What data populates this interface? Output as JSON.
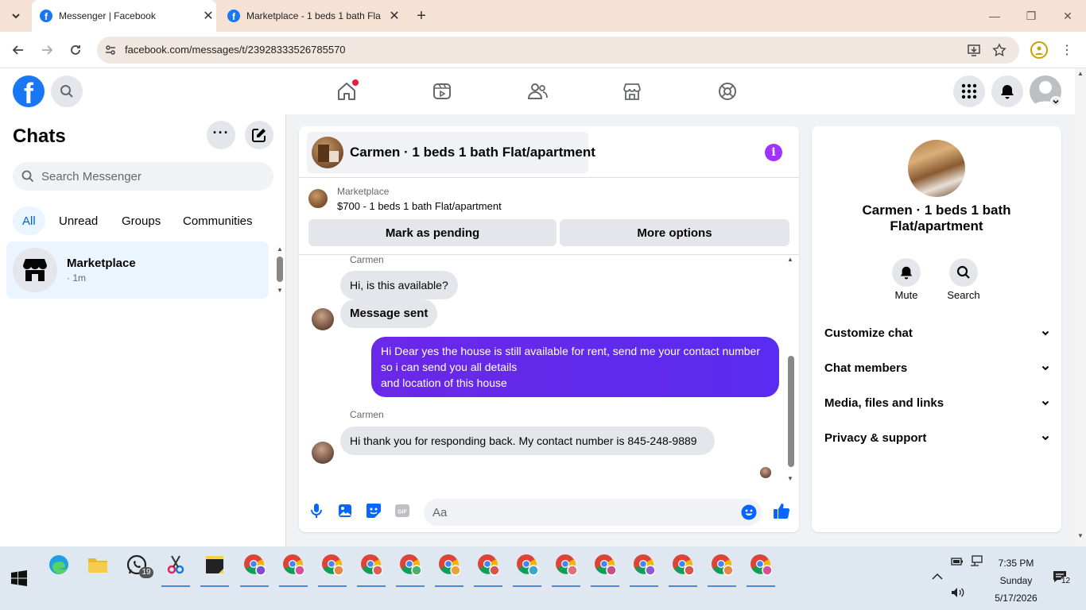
{
  "browser": {
    "tabs": [
      {
        "title": "Messenger | Facebook",
        "active": true
      },
      {
        "title": "Marketplace - 1 beds 1 bath Fla",
        "active": false
      }
    ],
    "url": "facebook.com/messages/t/23928333526785570"
  },
  "sidebar": {
    "title": "Chats",
    "search_placeholder": "Search Messenger",
    "filters": [
      "All",
      "Unread",
      "Groups",
      "Communities"
    ],
    "chats": [
      {
        "name": "Marketplace",
        "meta": "· 1m"
      }
    ]
  },
  "chat": {
    "header_name": "Carmen · 1 beds 1 bath Flat/apartment",
    "marketplace_label": "Marketplace",
    "listing": "$700 - 1 beds 1 bath Flat/apartment",
    "mark_pending": "Mark as pending",
    "more_options": "More options",
    "messages": [
      {
        "sender": "Carmen",
        "text": "Hi, is this available?"
      },
      {
        "text": "Message sent"
      },
      {
        "text": "Hi Dear yes the house is still available for rent, send me your contact number so i can send you all details\nand location of this house"
      },
      {
        "sender": "Carmen",
        "text": "Hi thank you for responding back. My contact number is 845-248-9889"
      }
    ],
    "input_placeholder": "Aa",
    "accent_color": "#a033ff"
  },
  "right_panel": {
    "name": "Carmen · 1 beds 1 bath Flat/apartment",
    "actions": [
      "Mute",
      "Search"
    ],
    "sections": [
      "Customize chat",
      "Chat members",
      "Media, files and links",
      "Privacy & support"
    ]
  },
  "taskbar": {
    "whatsapp_badge": "19",
    "time": "7:35 PM",
    "day": "Sunday",
    "date": "5/17/2026",
    "notif_count": "12"
  }
}
